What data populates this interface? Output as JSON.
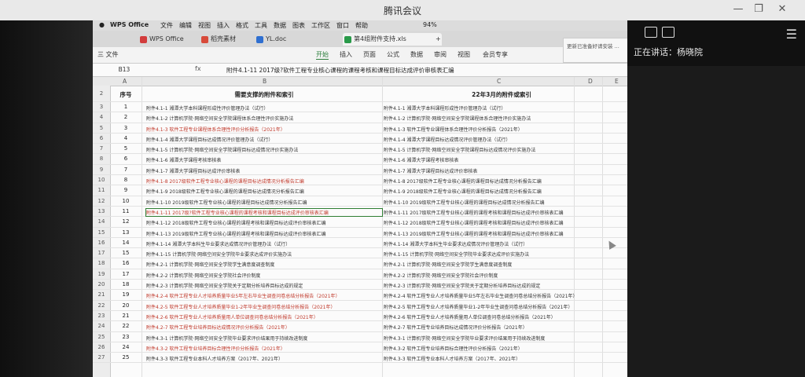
{
  "meeting": {
    "title": "腾讯会议",
    "speaking": "正在讲话：杨晓院"
  },
  "mac_menu": {
    "app": "WPS Office",
    "items": [
      "文件",
      "编辑",
      "视图",
      "插入",
      "格式",
      "工具",
      "数据",
      "图表",
      "工作区",
      "窗口",
      "帮助"
    ],
    "battery": "94%"
  },
  "tabs": [
    {
      "label": "WPS Office",
      "color": "#d23c3c"
    },
    {
      "label": "稻壳素材",
      "color": "#d84a3a"
    },
    {
      "label": "YL.doc",
      "color": "#2f6fd0"
    },
    {
      "label": "第4组附件支持.xls",
      "color": "#2a9a4a"
    }
  ],
  "ribbon": {
    "file": "三 文件",
    "tabs": [
      "开始",
      "插入",
      "页面",
      "公式",
      "数据",
      "审阅",
      "视图",
      "会员专享"
    ],
    "notice": "更新已准备好请安装 ..."
  },
  "formula_bar": {
    "cell": "B13",
    "fx": "fx",
    "content": "附件4.1-11 2017级?软件工程专业核心课程的课程考核和课程目标达成评价审核表汇编"
  },
  "columns": [
    "A",
    "B",
    "C",
    "D",
    "E"
  ],
  "header_row": {
    "a": "序号",
    "b": "需要支撑的附件和索引",
    "c": "22年3月的附件或索引"
  },
  "rows": [
    {
      "n": "3",
      "a": "1",
      "b": "附件4.1-1 湘潭大学本科课程形成性评价管理办法（试行）",
      "c": "附件4.1-1 湘潭大学本科课程形成性评价管理办法（试行）",
      "red": false
    },
    {
      "n": "4",
      "a": "2",
      "b": "附件4.1-2 计算机学院·网络空间安全学院课程体系合理性评价实施办法",
      "c": "附件4.1-2 计算机学院·网络空间安全学院课程体系合理性评价实施办法",
      "red": false
    },
    {
      "n": "5",
      "a": "3",
      "b": "附件4.1-3 软件工程专业课程体系合理性评价分析报告（2021年）",
      "c": "附件4.1-3 软件工程专业课程体系合理性评价分析报告（2021年）",
      "red": true
    },
    {
      "n": "6",
      "a": "4",
      "b": "附件4.1-4 湘潭大学课程目标达成情况评价管理办法（试行）",
      "c": "附件4.1-4 湘潭大学课程目标达成情况评价管理办法（试行）",
      "red": false
    },
    {
      "n": "7",
      "a": "5",
      "b": "附件4.1-5 计算机学院·网络空间安全学院课程目标达成情况评价实施办法",
      "c": "附件4.1-5 计算机学院·网络空间安全学院课程目标达成情况评价实施办法",
      "red": false
    },
    {
      "n": "8",
      "a": "6",
      "b": "附件4.1-6 湘潭大学课程考核审核表",
      "c": "附件4.1-6 湘潭大学课程考核审核表",
      "red": false
    },
    {
      "n": "9",
      "a": "7",
      "b": "附件4.1-7 湘潭大学课程目标达成评价审核表",
      "c": "附件4.1-7 湘潭大学课程目标达成评价审核表",
      "red": false
    },
    {
      "n": "10",
      "a": "8",
      "b": "附件4.1-8 2017级软件工程专业核心课程的课程目标达成情况分析报告汇编",
      "c": "附件4.1-8 2017级软件工程专业核心课程的课程目标达成情况分析报告汇编",
      "red": true
    },
    {
      "n": "11",
      "a": "9",
      "b": "附件4.1-9 2018级软件工程专业核心课程的课程目标达成情况分析报告汇编",
      "c": "附件4.1-9 2018级软件工程专业核心课程的课程目标达成情况分析报告汇编",
      "red": false
    },
    {
      "n": "12",
      "a": "10",
      "b": "附件4.1-10 2019级软件工程专业核心课程的课程目标达成情况分析报告汇编",
      "c": "附件4.1-10 2019级软件工程专业核心课程的课程目标达成情况分析报告汇编",
      "red": false
    },
    {
      "n": "13",
      "a": "11",
      "b": "附件4.1-11 2017级?软件工程专业核心课程的课程考核和课程目标达成评价审核表汇编",
      "c": "附件4.1-11 2017级软件工程专业核心课程的课程考核和课程目标达成评价审核表汇编",
      "red": true,
      "sel": true
    },
    {
      "n": "14",
      "a": "12",
      "b": "附件4.1-12 2018级软件工程专业核心课程的课程考核和课程目标达成评价审核表汇编",
      "c": "附件4.1-12 2018级软件工程专业核心课程的课程考核和课程目标达成评价审核表汇编",
      "red": false
    },
    {
      "n": "15",
      "a": "13",
      "b": "附件4.1-13 2019级软件工程专业核心课程的课程考核和课程目标达成评价审核表汇编",
      "c": "附件4.1-13 2019级软件工程专业核心课程的课程考核和课程目标达成评价审核表汇编",
      "red": false
    },
    {
      "n": "16",
      "a": "14",
      "b": "附件4.1-14 湘潭大学本科生毕业要求达成情况评价管理办法（试行）",
      "c": "附件4.1-14 湘潭大学本科生毕业要求达成情况评价管理办法（试行）",
      "red": false
    },
    {
      "n": "17",
      "a": "15",
      "b": "附件4.1-15 计算机学院·网络空间安全学院毕业要求达成评价实施办法",
      "c": "附件4.1-15 计算机学院·网络空间安全学院毕业要求达成评价实施办法",
      "red": false
    },
    {
      "n": "18",
      "a": "16",
      "b": "附件4.2-1 计算机学院·网络空间安全学院学生满意度调查制度",
      "c": "附件4.2-1 计算机学院·网络空间安全学院学生满意度调查制度",
      "red": false
    },
    {
      "n": "19",
      "a": "17",
      "b": "附件4.2-2 计算机学院·网络空间安全学院社会评价制度",
      "c": "附件4.2-2 计算机学院·网络空间安全学院社会评价制度",
      "red": false
    },
    {
      "n": "20",
      "a": "18",
      "b": "附件4.2-3 计算机学院·网络空间安全学院关于定期分析培养目标达成的规定",
      "c": "附件4.2-3 计算机学院·网络空间安全学院关于定期分析培养目标达成的规定",
      "red": false
    },
    {
      "n": "21",
      "a": "19",
      "b": "附件4.2-4 软件工程专业人才培养质量毕业5年左右毕业生调查问卷总结分析报告（2021年）",
      "c": "附件4.2-4 软件工程专业人才培养质量毕业5年左右毕业生调查问卷总结分析报告（2021年）",
      "red": true
    },
    {
      "n": "22",
      "a": "20",
      "b": "附件4.2-5 软件工程专业人才培养质量毕业1-2年毕业生调查问卷总结分析报告（2021年）",
      "c": "附件4.2-5 软件工程专业人才培养质量毕业1-2年毕业生调查问卷总结分析报告（2021年）",
      "red": true
    },
    {
      "n": "23",
      "a": "21",
      "b": "附件4.2-6 软件工程专业人才培养质量用人单位调查问卷总结分析报告（2021年）",
      "c": "附件4.2-6 软件工程专业人才培养质量用人单位调查问卷总结分析报告（2021年）",
      "red": true
    },
    {
      "n": "24",
      "a": "22",
      "b": "附件4.2-7 软件工程专业培养目标达成情况评价分析报告（2021年）",
      "c": "附件4.2-7 软件工程专业培养目标达成情况评价分析报告（2021年）",
      "red": true
    },
    {
      "n": "25",
      "a": "23",
      "b": "附件4.3-1 计算机学院·网络空间安全学院毕业要求评价结果用于持续改进制度",
      "c": "附件4.3-1 计算机学院·网络空间安全学院毕业要求评价结果用于持续改进制度",
      "red": false
    },
    {
      "n": "26",
      "a": "24",
      "b": "附件4.3-2 软件工程专业培养目标合理性评价分析报告（2021年）",
      "c": "附件4.3-2 软件工程专业培养目标合理性评价分析报告（2021年）",
      "red": true
    },
    {
      "n": "27",
      "a": "25",
      "b": "附件4.3-3 软件工程专业本科人才培养方案（2017年、2021年）",
      "c": "附件4.3-3 软件工程专业本科人才培养方案（2017年、2021年）",
      "red": false
    }
  ]
}
